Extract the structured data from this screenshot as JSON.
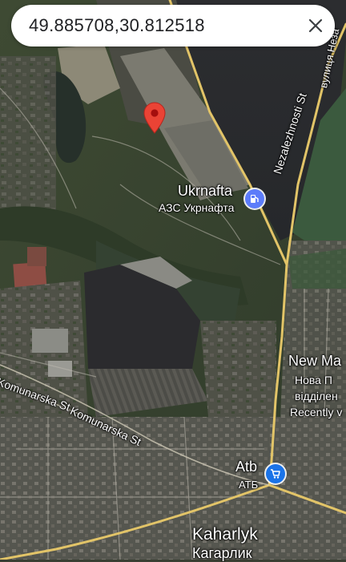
{
  "search": {
    "value": "49.885708,30.812518"
  },
  "pois": {
    "fuel": {
      "name": "Ukrnafta",
      "subname": "АЗС Укрнафта"
    },
    "store": {
      "name": "Atb",
      "subname": "АТБ"
    },
    "partial": {
      "line1": "New Ma",
      "line2": "Нова П",
      "line3": "відділен",
      "line4": "Recently v"
    }
  },
  "streets": {
    "nezalezhnosti": "Nezalezhnosti St",
    "vulytsia": "вулиця Неза",
    "komunarska_1": "Komunarska St",
    "komunarska_2": "Komunarska St"
  },
  "places": {
    "town": "Kaharlyk",
    "town_native": "Кагарлик"
  },
  "colors": {
    "pin": "#ea4335",
    "fuel_icon": "#5c7cfa",
    "shop_icon": "#1a73e8",
    "road": "#e2c468"
  },
  "icons": {
    "clear": "close-icon",
    "pin": "location-pin-icon",
    "fuel": "gas-station-icon",
    "store": "shopping-cart-icon"
  }
}
